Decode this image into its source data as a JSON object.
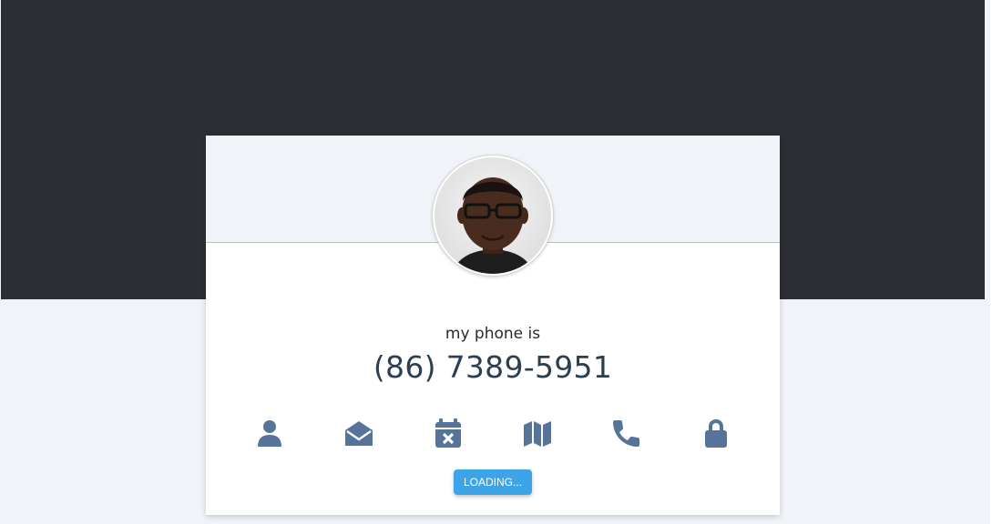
{
  "profile": {
    "caption": "my phone is",
    "value": "(86) 7389-5951",
    "avatar_icon": "person-photo"
  },
  "icons": [
    {
      "name": "user-icon"
    },
    {
      "name": "envelope-open-icon"
    },
    {
      "name": "calendar-x-icon"
    },
    {
      "name": "map-icon"
    },
    {
      "name": "phone-icon"
    },
    {
      "name": "lock-icon"
    }
  ],
  "button": {
    "label": "LOADING..."
  },
  "colors": {
    "header": "#2c2e33",
    "page_background": "#f0f4f8",
    "icon": "#56749a",
    "button": "#3ea4e8",
    "value_text": "#2c3e50"
  }
}
